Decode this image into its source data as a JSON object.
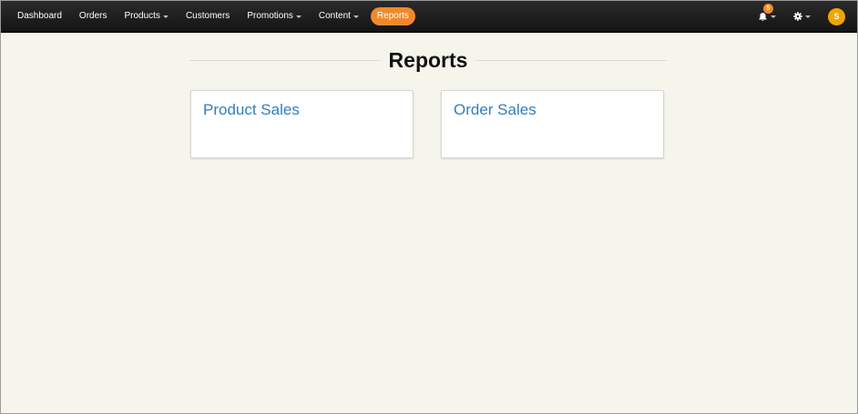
{
  "nav": {
    "items": [
      {
        "label": "Dashboard",
        "dropdown": false,
        "active": false
      },
      {
        "label": "Orders",
        "dropdown": false,
        "active": false
      },
      {
        "label": "Products",
        "dropdown": true,
        "active": false
      },
      {
        "label": "Customers",
        "dropdown": false,
        "active": false
      },
      {
        "label": "Promotions",
        "dropdown": true,
        "active": false
      },
      {
        "label": "Content",
        "dropdown": true,
        "active": false
      },
      {
        "label": "Reports",
        "dropdown": false,
        "active": true
      }
    ],
    "notifications_count": "5",
    "avatar_initial": "S"
  },
  "page": {
    "title": "Reports",
    "cards": [
      {
        "title": "Product Sales"
      },
      {
        "title": "Order Sales"
      }
    ]
  },
  "colors": {
    "accent": "#f0892b",
    "avatar": "#f0a500",
    "link": "#2f7fc0",
    "background": "#f5f5ec",
    "navbar": "#1a1a1a"
  },
  "icons": {
    "notifications": "bell-icon",
    "settings": "gear-icon",
    "dropdown": "caret-down-icon"
  }
}
